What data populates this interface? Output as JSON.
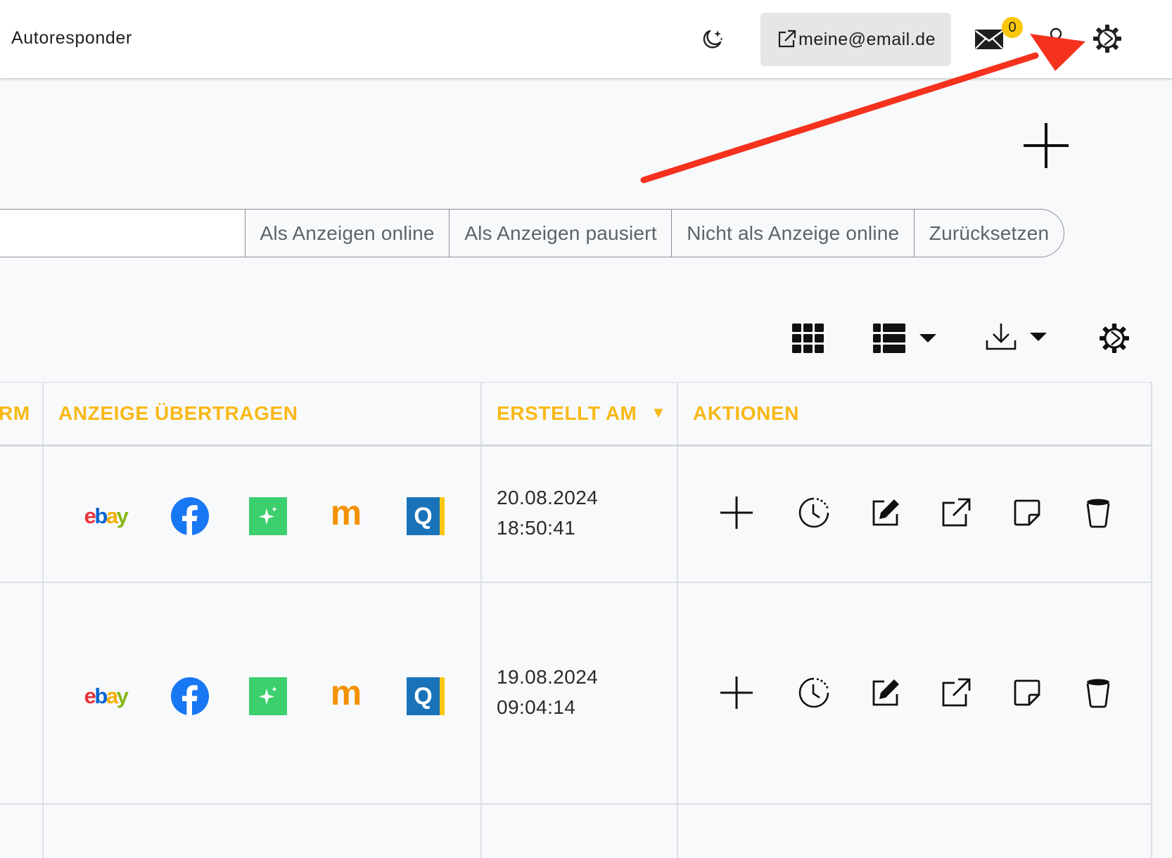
{
  "navbar": {
    "autoresponder_label": "Autoresponder",
    "email_label": "meine@email.de",
    "mail_badge_count": "0",
    "icons": [
      "moon-stars-icon",
      "external-link-icon",
      "envelope-icon",
      "user-icon",
      "gear-icon"
    ]
  },
  "filters": {
    "search_value": "",
    "buttons": [
      "Als Anzeigen online",
      "Als Anzeigen pausiert",
      "Nicht als Anzeige online",
      "Zurücksetzen"
    ]
  },
  "toolbar": {
    "icons": [
      "grid-view-icon",
      "list-view-icon",
      "download-icon",
      "gear-icon"
    ]
  },
  "table": {
    "headers": {
      "platform_partial": "RM",
      "transfer": "ANZEIGE ÜBERTRAGEN",
      "created": "ERSTELLT AM",
      "sort_indicator": "▼",
      "actions": "AKTIONEN"
    },
    "platforms": {
      "ebay_letters": [
        "e",
        "b",
        "a",
        "y"
      ],
      "quoka_letter": "Q",
      "markt_letter": "m"
    },
    "rows": [
      {
        "date": "20.08.2024",
        "time": "18:50:41"
      },
      {
        "date": "19.08.2024",
        "time": "09:04:14"
      }
    ]
  },
  "colors": {
    "header_text": "#f8b916",
    "badge": "#f9c80e",
    "annotation_arrow": "#f4321e",
    "ebay": [
      "#e53238",
      "#0064d2",
      "#f5af02",
      "#86b817"
    ],
    "facebook": "#1877f2",
    "sparkle_tile": "#3ccf6e",
    "markt": "#f39200",
    "quoka_blue": "#1a73b8",
    "quoka_stripe": "#f9c80e"
  }
}
